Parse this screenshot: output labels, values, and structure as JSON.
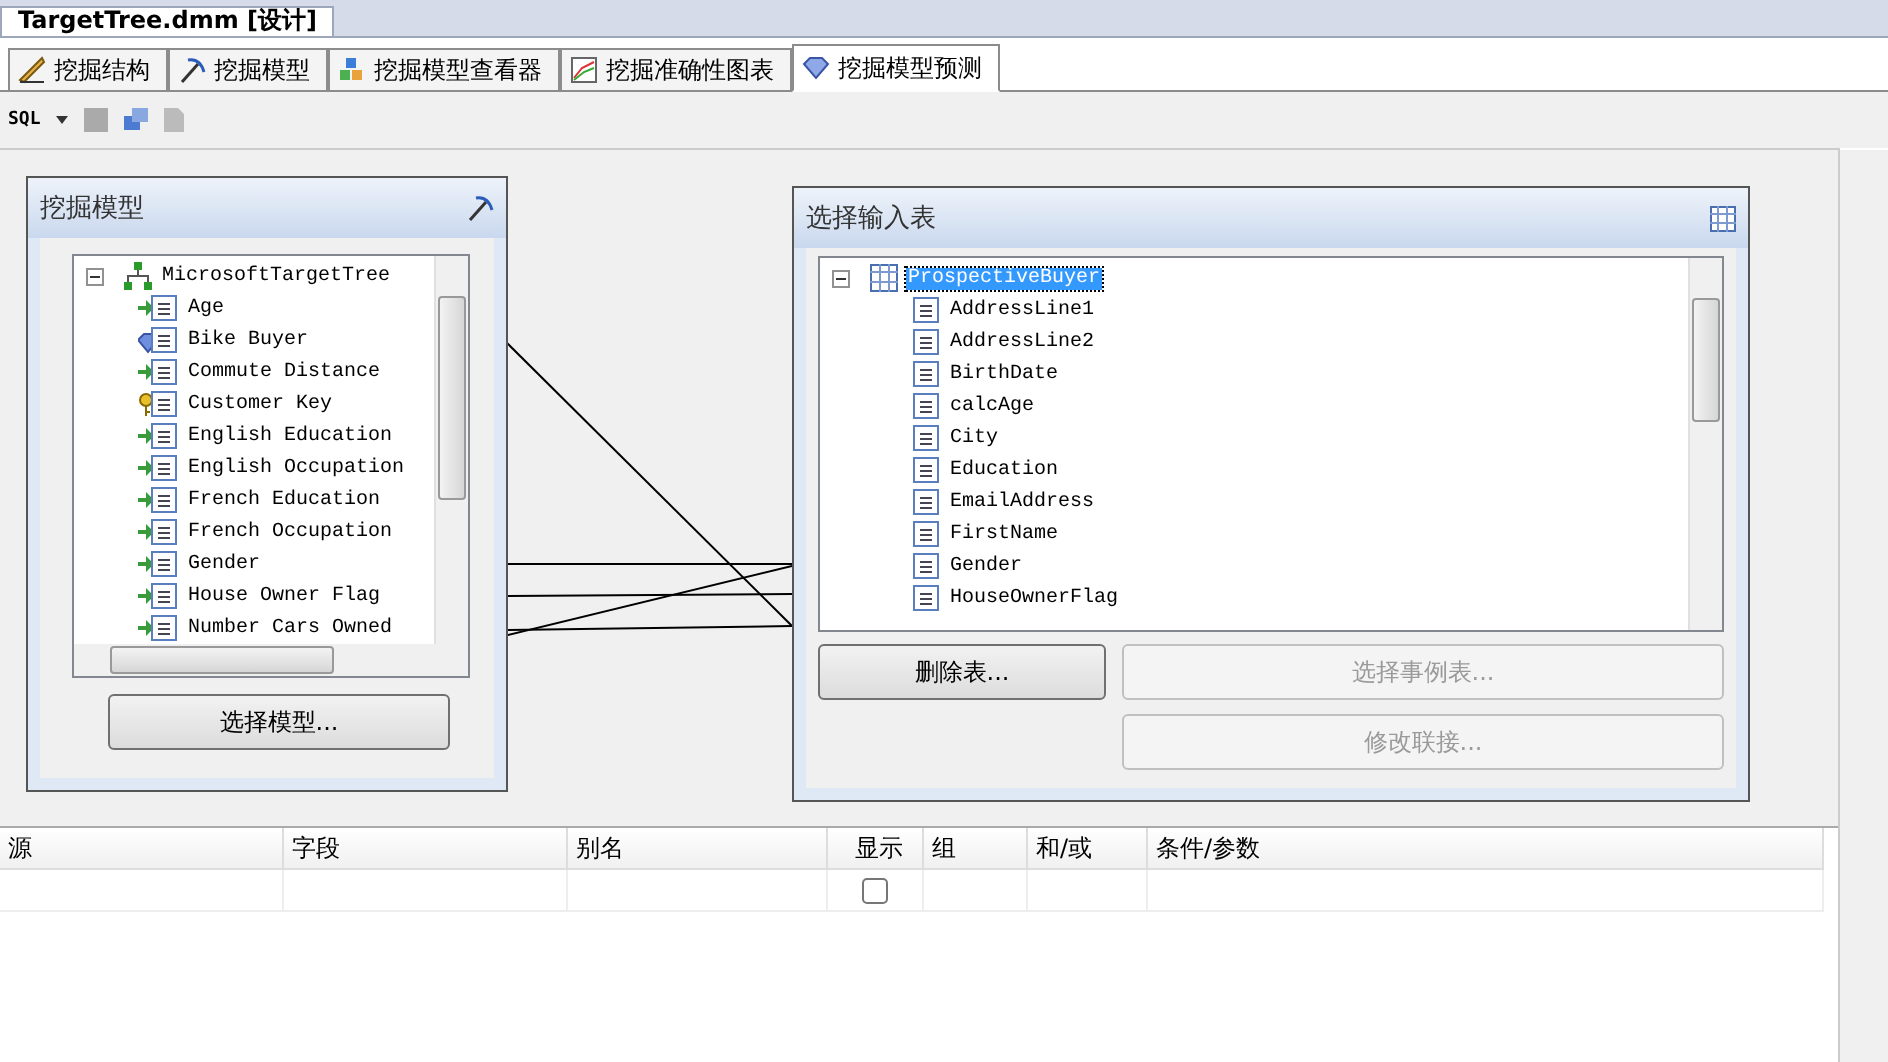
{
  "document_tab": {
    "title": "TargetTree.dmm [设计]"
  },
  "tabs": [
    {
      "label": "挖掘结构",
      "selected": false,
      "kind": "structure"
    },
    {
      "label": "挖掘模型",
      "selected": false,
      "kind": "model"
    },
    {
      "label": "挖掘模型查看器",
      "selected": false,
      "kind": "viewer"
    },
    {
      "label": "挖掘准确性图表",
      "selected": false,
      "kind": "chart"
    },
    {
      "label": "挖掘模型预测",
      "selected": true,
      "kind": "predict"
    }
  ],
  "toolbar": {
    "sql_label": "SQL"
  },
  "model_panel": {
    "title": "挖掘模型",
    "tree": {
      "label": "MicrosoftTargetTree",
      "expanded": true,
      "children": [
        {
          "label": "Age",
          "kind": "input"
        },
        {
          "label": "Bike Buyer",
          "kind": "predict"
        },
        {
          "label": "Commute Distance",
          "kind": "input"
        },
        {
          "label": "Customer Key",
          "kind": "key"
        },
        {
          "label": "English Education",
          "kind": "input"
        },
        {
          "label": "English Occupation",
          "kind": "input"
        },
        {
          "label": "French Education",
          "kind": "input"
        },
        {
          "label": "French Occupation",
          "kind": "input"
        },
        {
          "label": "Gender",
          "kind": "input"
        },
        {
          "label": "House Owner Flag",
          "kind": "input"
        },
        {
          "label": "Number Cars Owned",
          "kind": "input"
        }
      ]
    },
    "button": {
      "label": "选择模型...",
      "disabled": false
    }
  },
  "input_panel": {
    "title": "选择输入表",
    "tree": {
      "label": "ProspectiveBuyer",
      "expanded": true,
      "selected": true,
      "children": [
        {
          "label": "AddressLine1"
        },
        {
          "label": "AddressLine2"
        },
        {
          "label": "BirthDate"
        },
        {
          "label": "calcAge"
        },
        {
          "label": "City"
        },
        {
          "label": "Education"
        },
        {
          "label": "EmailAddress"
        },
        {
          "label": "FirstName"
        },
        {
          "label": "Gender"
        },
        {
          "label": "HouseOwnerFlag"
        }
      ]
    },
    "buttons": [
      {
        "label": "删除表...",
        "disabled": false
      },
      {
        "label": "选择事例表...",
        "disabled": true
      },
      {
        "label": "修改联接...",
        "disabled": true
      }
    ]
  },
  "grid": {
    "columns": [
      "源",
      "字段",
      "别名",
      "显示",
      "组",
      "和/或",
      "条件/参数"
    ],
    "rows": [
      {
        "show_checked": false
      }
    ]
  }
}
